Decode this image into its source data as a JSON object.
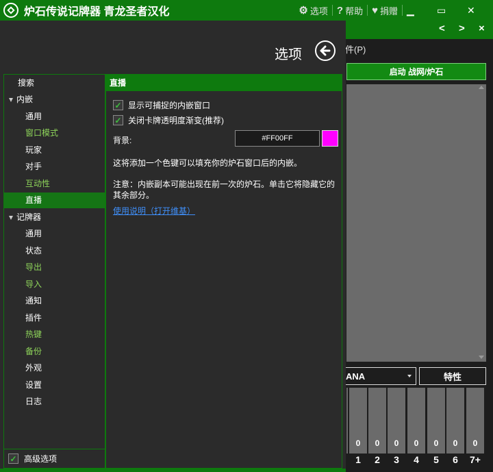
{
  "titlebar": {
    "title": "炉石传说记牌器 青龙圣者汉化",
    "options_label": "选项",
    "help_label": "帮助",
    "donate_label": "捐赠",
    "minimize": "▁",
    "maximize": "▭",
    "close": "✕"
  },
  "background_panel": {
    "nav_prev": "<",
    "nav_next": ">",
    "nav_close": "×",
    "menu_text": "件(P)",
    "launch_label": "启动 战网/炉石",
    "deck_selector": "ANA",
    "attribute_button": "特性",
    "mana_counts": [
      "",
      "0",
      "0",
      "0",
      "0",
      "0",
      "0",
      "0"
    ],
    "mana_costs": [
      "",
      "1",
      "2",
      "3",
      "4",
      "5",
      "6",
      "7+"
    ]
  },
  "options": {
    "header": "选项",
    "sidebar": {
      "search": "搜索",
      "overlay_group": "内嵌",
      "overlay_items": [
        "通用",
        "窗口模式",
        "玩家",
        "对手",
        "互动性",
        "直播"
      ],
      "tracker_group": "记牌器",
      "tracker_items": [
        "通用",
        "状态",
        "导出",
        "导入",
        "通知",
        "插件",
        "热键",
        "备份",
        "外观",
        "设置",
        "日志"
      ],
      "advanced_label": "高级选项"
    },
    "streaming": {
      "title": "直播",
      "show_overlay_window": "显示可捕捉的内嵌窗口",
      "disable_card_fade": "关闭卡牌透明度渐变(推荐)",
      "background_label": "背景:",
      "background_value": "#FF00FF",
      "desc1": "这将添加一个色键可以填充你的炉石窗口后的内嵌。",
      "desc2": "注意：内嵌副本可能出现在前一次的炉石。单击它将隐藏它的其余部分。",
      "usage_link": "使用说明（打开维基）"
    }
  },
  "colors": {
    "accent": "#0e7a0e",
    "highlight_green": "#8ed45a",
    "link": "#3f8ef7",
    "swatch": "#FF00FF"
  }
}
